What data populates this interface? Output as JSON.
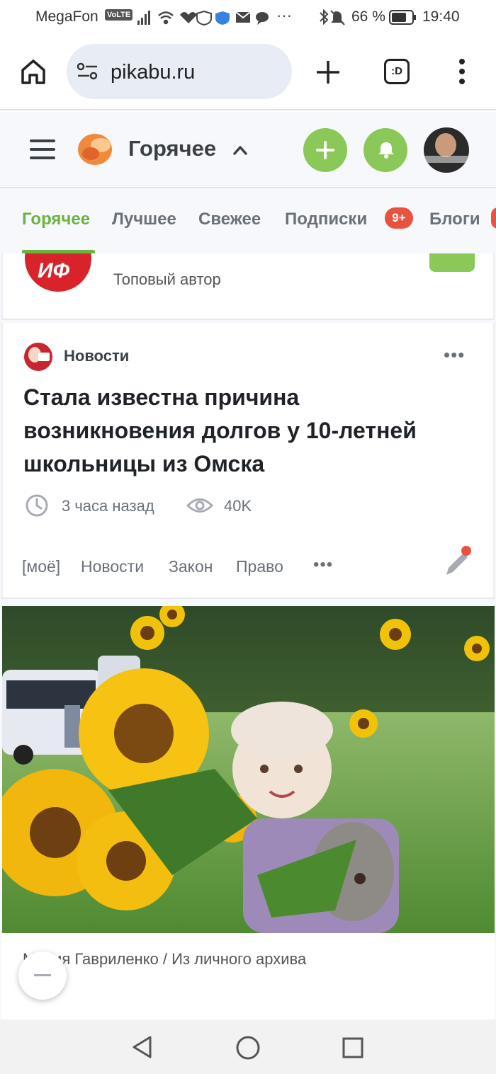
{
  "status_bar": {
    "carrier": "MegaFon",
    "volte": "VoLTE",
    "battery": "66 %",
    "time": "19:40"
  },
  "browser": {
    "url": "pikabu.ru",
    "tab_count": ":D"
  },
  "site_header": {
    "title": "Горячее",
    "colors": {
      "accent": "#8ac858",
      "logo": "#f08a3a"
    }
  },
  "nav_tabs": {
    "items": [
      {
        "label": "Горячее",
        "active": true
      },
      {
        "label": "Лучшее"
      },
      {
        "label": "Свежее"
      },
      {
        "label": "Подписки",
        "badge": "9+"
      },
      {
        "label": "Блоги"
      }
    ]
  },
  "prev_card": {
    "logo_text": "ИФ",
    "subtitle": "Топовый автор"
  },
  "post": {
    "community": "Новости",
    "title": "Стала известна причина возникновения долгов у 10-летней школьницы из Омска",
    "time_ago": "3 часа назад",
    "views": "40K",
    "tags": [
      "[моё]",
      "Новости",
      "Закон",
      "Право"
    ],
    "image_caption": "Мария Гавриленко / Из личного архива"
  }
}
